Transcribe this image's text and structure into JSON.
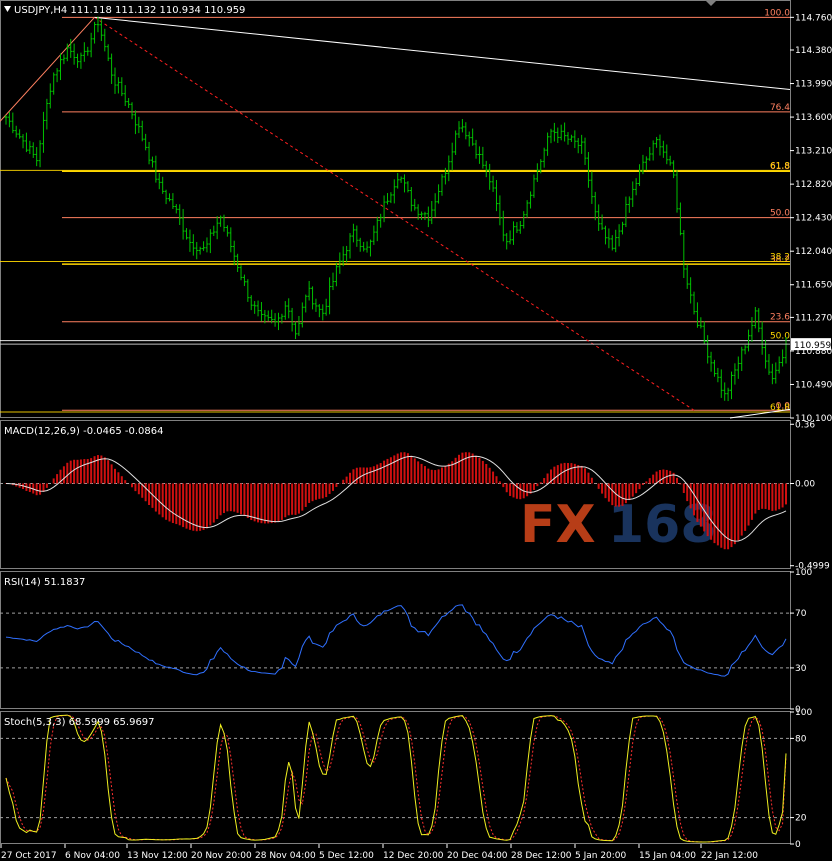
{
  "chart_data": [
    {
      "type": "bar",
      "panel": "price",
      "header": "USDJPY,H4  111.118 111.132 110.934 110.959",
      "symbol_icon": "triangle-down-icon",
      "ylim": [
        110.1,
        114.95
      ],
      "y_ticks": [
        "114.760",
        "114.380",
        "113.990",
        "113.600",
        "113.210",
        "112.820",
        "112.430",
        "112.040",
        "111.650",
        "111.270",
        "110.880",
        "110.490",
        "110.100"
      ],
      "y_tick_values": [
        114.76,
        114.38,
        113.99,
        113.6,
        113.21,
        112.82,
        112.43,
        112.04,
        111.65,
        111.27,
        110.88,
        110.49,
        110.1
      ],
      "current_price_label": "110.959",
      "current_price": 110.959,
      "x_tick_labels": [
        "27 Oct 2017",
        "6 Nov 04:00",
        "13 Nov 12:00",
        "20 Nov 20:00",
        "28 Nov 04:00",
        "5 Dec 12:00",
        "12 Dec 20:00",
        "20 Dec 04:00",
        "28 Dec 12:00",
        "5 Jan 20:00",
        "15 Jan 04:00",
        "22 Jan 12:00"
      ],
      "bar_count": 230,
      "close_anchors": [
        [
          0,
          113.6
        ],
        [
          6,
          113.35
        ],
        [
          12,
          113.1
        ],
        [
          18,
          114.05
        ],
        [
          24,
          114.4
        ],
        [
          30,
          114.25
        ],
        [
          36,
          114.72
        ],
        [
          42,
          114.05
        ],
        [
          48,
          113.75
        ],
        [
          55,
          113.25
        ],
        [
          60,
          112.8
        ],
        [
          66,
          112.55
        ],
        [
          72,
          112.15
        ],
        [
          78,
          112.05
        ],
        [
          84,
          112.45
        ],
        [
          90,
          111.95
        ],
        [
          96,
          111.45
        ],
        [
          100,
          111.25
        ],
        [
          106,
          111.2
        ],
        [
          110,
          111.45
        ],
        [
          114,
          111.05
        ],
        [
          118,
          111.6
        ],
        [
          124,
          111.3
        ],
        [
          130,
          111.85
        ],
        [
          136,
          112.25
        ],
        [
          142,
          112.05
        ],
        [
          148,
          112.55
        ],
        [
          154,
          112.95
        ],
        [
          160,
          112.55
        ],
        [
          166,
          112.45
        ],
        [
          172,
          112.95
        ],
        [
          178,
          113.55
        ],
        [
          184,
          113.25
        ],
        [
          190,
          112.85
        ],
        [
          196,
          112.15
        ],
        [
          202,
          112.4
        ],
        [
          208,
          112.95
        ],
        [
          214,
          113.45
        ],
        [
          220,
          113.35
        ],
        [
          226,
          113.25
        ],
        [
          232,
          112.35
        ],
        [
          238,
          112.05
        ],
        [
          244,
          112.6
        ],
        [
          250,
          113.05
        ],
        [
          256,
          113.35
        ],
        [
          262,
          112.9
        ],
        [
          266,
          111.85
        ],
        [
          270,
          111.35
        ],
        [
          276,
          110.8
        ],
        [
          282,
          110.35
        ],
        [
          288,
          110.8
        ],
        [
          294,
          111.3
        ],
        [
          300,
          110.55
        ],
        [
          306,
          110.9
        ]
      ],
      "fib_set_1": [
        {
          "label": "100.0",
          "value": 114.76
        },
        {
          "label": "76.4",
          "value": 113.66
        },
        {
          "label": "61.8",
          "value": 112.97
        },
        {
          "label": "50.0",
          "value": 112.43
        },
        {
          "label": "38.2",
          "value": 111.89
        },
        {
          "label": "23.6",
          "value": 111.22
        },
        {
          "label": "0.0",
          "value": 110.19
        }
      ],
      "fib_set_2": [
        {
          "label": "61.8",
          "value": 112.98
        },
        {
          "label": "50.0",
          "value": 111.0
        },
        {
          "label": "38.2",
          "value": 111.92
        },
        {
          "label": "61.8",
          "value": 110.17
        }
      ],
      "colors": {
        "bars": "#00c000",
        "fib": "#ff8060",
        "fib_strong": "#ffd700",
        "trend_diag": "#ff2020",
        "trendline": "#ffffff",
        "grid": "#808080"
      }
    },
    {
      "type": "bar",
      "panel": "macd",
      "header": "MACD(12,26,9) -0.0465 -0.0864",
      "ylim": [
        -0.52,
        0.38
      ],
      "y_ticks": [
        "0.36",
        "0.00",
        "-0.4999"
      ],
      "y_tick_values": [
        0.36,
        0.0,
        -0.4999
      ],
      "zero_line": 0.0,
      "colors": {
        "histogram": "#d01010",
        "signal": "#e0e0e0"
      }
    },
    {
      "type": "line",
      "panel": "rsi",
      "header": "RSI(14) 51.1837",
      "ylim": [
        0,
        100
      ],
      "y_ticks": [
        "100",
        "70",
        "30",
        "0"
      ],
      "y_tick_values": [
        100,
        70,
        30,
        0
      ],
      "levels": [
        70,
        30
      ],
      "colors": {
        "line": "#3070ff"
      }
    },
    {
      "type": "line",
      "panel": "stoch",
      "header": "Stoch(5,3,3) 68.5999 65.9697",
      "ylim": [
        0,
        100
      ],
      "y_ticks": [
        "100",
        "80",
        "20",
        "0"
      ],
      "y_tick_values": [
        100,
        80,
        20,
        0
      ],
      "levels": [
        80,
        20
      ],
      "colors": {
        "main": "#f0f020",
        "signal": "#ff3030"
      }
    }
  ],
  "watermark": "FX168",
  "watermark_colors": {
    "fx": "#d8481c",
    "num": "#1e3d6e"
  }
}
